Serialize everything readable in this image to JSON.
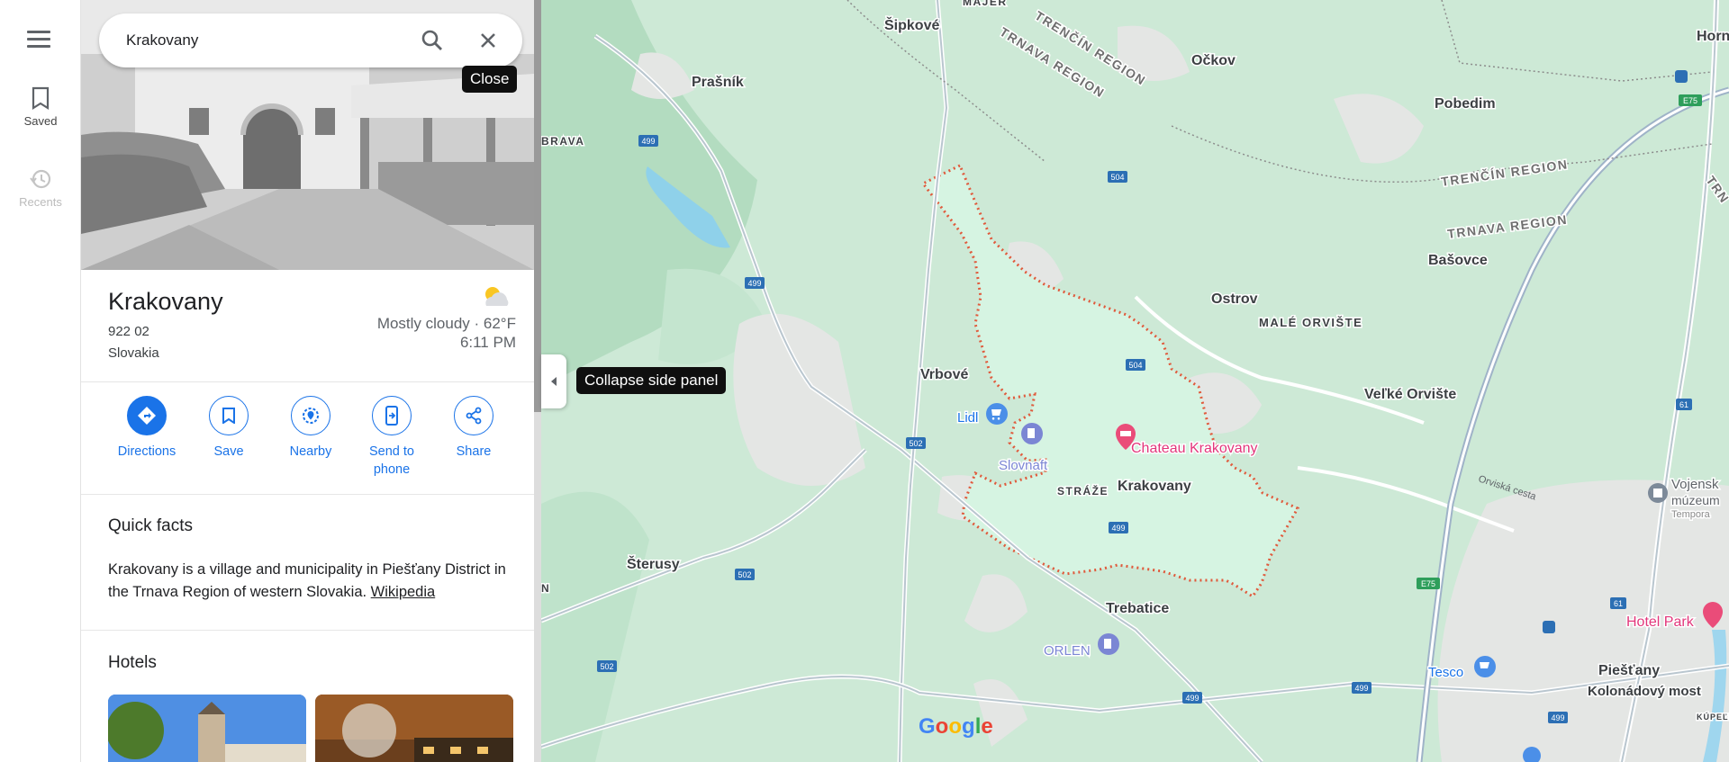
{
  "rail": {
    "saved_label": "Saved",
    "recents_label": "Recents"
  },
  "search": {
    "value": "Krakovany",
    "close_tooltip": "Close"
  },
  "place": {
    "title": "Krakovany",
    "postal": "922 02",
    "country": "Slovakia",
    "weather": "Mostly cloudy · 62°F",
    "time": "6:11 PM",
    "weather_icon": "partly-cloudy-icon"
  },
  "actions": [
    {
      "label": "Directions",
      "icon": "directions-icon"
    },
    {
      "label": "Save",
      "icon": "bookmark-icon"
    },
    {
      "label": "Nearby",
      "icon": "nearby-icon"
    },
    {
      "label": "Send to\nphone",
      "line1": "Send to",
      "line2": "phone",
      "icon": "send-to-phone-icon"
    },
    {
      "label": "Share",
      "icon": "share-icon"
    }
  ],
  "quick_facts": {
    "heading": "Quick facts",
    "text": "Krakovany is a village and municipality in Piešťany District in the Trnava Region of western Slovakia.",
    "link": "Wikipedia"
  },
  "hotels": {
    "heading": "Hotels"
  },
  "collapse_tooltip": "Collapse side panel",
  "map": {
    "labels": {
      "sipkove": "Šipkové",
      "majer": "MAJER",
      "trencin_region_top": "TRENČÍN REGION",
      "trnava_region_top": "TRNAVA REGION",
      "ockov": "Očkov",
      "horna": "Horn",
      "prasnik": "Prašník",
      "brava": "BRAVA",
      "pobedim": "Pobedim",
      "trencin_region_right": "TRENČÍN REGION",
      "trnava_region_right": "TRNAVA REGION",
      "tr_edge": "TRN",
      "basovce": "Bašovce",
      "ostrov": "Ostrov",
      "male_orviste": "MALÉ ORVIŠTE",
      "vrbove": "Vrbové",
      "velke_orviste": "Veľké Orvište",
      "lidl": "Lidl",
      "slovnaft": "Slovnaft",
      "chateau": "Chateau Krakovany",
      "straze": "STRÁŽE",
      "krakovany": "Krakovany",
      "orvisska": "Orviská cesta",
      "vojensk": "Vojensk",
      "muzeum": "múzeum",
      "tempora": "Tempora",
      "sterusy": "Šterusy",
      "n_edge": "N",
      "trebatice": "Trebatice",
      "orlen": "ORLEN",
      "hotel_park": "Hotel Park",
      "tesco": "Tesco",
      "piestany": "Piešťany",
      "kolonadovy": "Kolonádový most",
      "kupelny": "KÚPEĽNÝ",
      "google": "Google"
    },
    "road_shields": {
      "r499": "499",
      "r504": "504",
      "r502": "502",
      "r61": "61",
      "e75": "E75"
    }
  }
}
